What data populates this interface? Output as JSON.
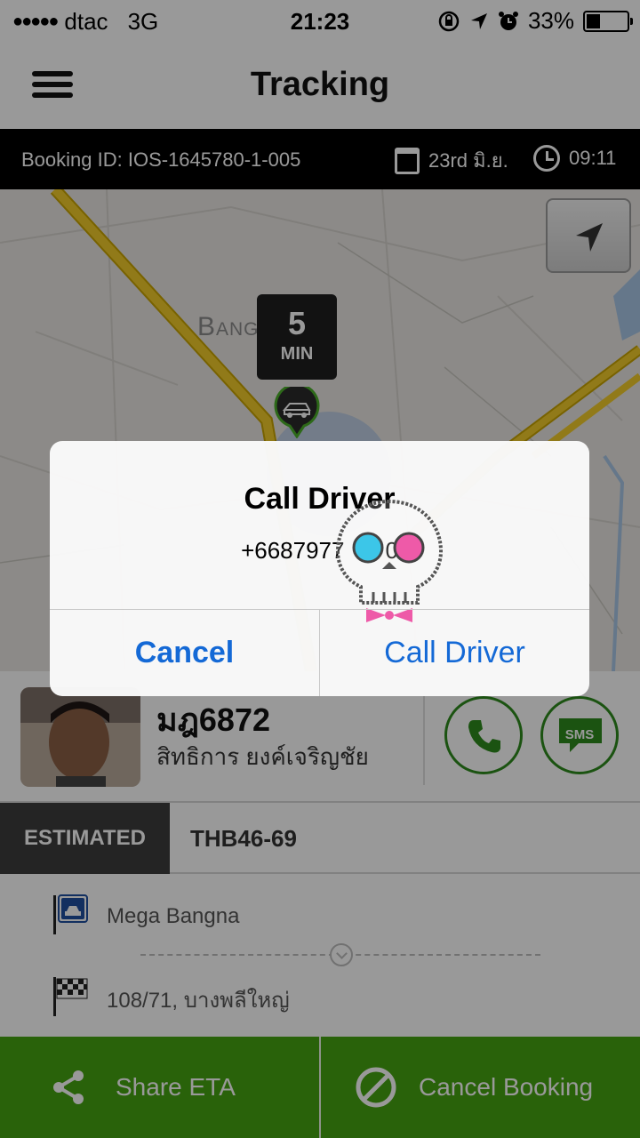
{
  "status_bar": {
    "carrier": "dtac",
    "network": "3G",
    "time": "21:23",
    "battery": "33%",
    "battery_level": 0.33
  },
  "header": {
    "title": "Tracking",
    "menu_icon": "hamburger-icon"
  },
  "booking": {
    "id_text": "Booking ID: IOS-1645780-1-005",
    "date": "23rd มิ.ย.",
    "time": "09:11"
  },
  "map": {
    "area_label": "Bang Kaeo",
    "eta_value": "5",
    "eta_unit": "MIN",
    "locate_icon": "navigation-arrow-icon"
  },
  "driver": {
    "plate": "มฎ6872",
    "name": "สิทธิการ  ยงค์เจริญชัย",
    "call_icon": "phone-icon",
    "sms_label": "SMS"
  },
  "estimate": {
    "label": "ESTIMATED",
    "value": "THB46-69"
  },
  "route": {
    "pickup": "Mega Bangna",
    "dropoff": "108/71, บางพลีใหญ่"
  },
  "actions": {
    "share_label": "Share ETA",
    "cancel_label": "Cancel Booking"
  },
  "alert": {
    "title": "Call Driver",
    "message": "+6687977",
    "message_tail": "0",
    "cancel": "Cancel",
    "confirm": "Call Driver"
  },
  "colors": {
    "brand_green": "#45a312",
    "ios_blue": "#1469d6",
    "dark_bar": "#000000"
  }
}
